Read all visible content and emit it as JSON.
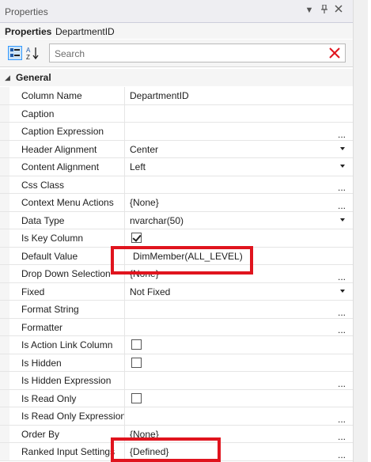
{
  "panel": {
    "title": "Properties",
    "header_label": "Properties",
    "object_name": "DepartmentID",
    "dropdown_icon": "chevron-down-icon",
    "pin_icon": "pin-icon",
    "close_icon": "close-icon"
  },
  "toolbar": {
    "categorized_icon": "categorized-icon",
    "alphabetical_icon": "sort-az-icon",
    "search_placeholder": "Search",
    "search_value": "",
    "clear_icon": "clear-search-icon"
  },
  "category": {
    "name": "General",
    "expanded_glyph": "◢"
  },
  "ellipsis": "...",
  "properties": [
    {
      "name": "Column Name",
      "value": "DepartmentID"
    },
    {
      "name": "Caption",
      "value": ""
    },
    {
      "name": "Caption Expression",
      "value": ""
    },
    {
      "name": "Header Alignment",
      "value": "Center"
    },
    {
      "name": "Content Alignment",
      "value": "Left"
    },
    {
      "name": "Css Class",
      "value": ""
    },
    {
      "name": "Context Menu Actions",
      "value": "{None}"
    },
    {
      "name": "Data Type",
      "value": "nvarchar(50)"
    },
    {
      "name": "Is Key Column",
      "value": "",
      "checked": true
    },
    {
      "name": "Default Value",
      "value": "DimMember(ALL_LEVEL)"
    },
    {
      "name": "Drop Down Selection",
      "value": "{None}"
    },
    {
      "name": "Fixed",
      "value": "Not Fixed"
    },
    {
      "name": "Format String",
      "value": ""
    },
    {
      "name": "Formatter",
      "value": ""
    },
    {
      "name": "Is Action Link Column",
      "value": "",
      "checked": false
    },
    {
      "name": "Is Hidden",
      "value": "",
      "checked": false
    },
    {
      "name": "Is Hidden Expression",
      "value": ""
    },
    {
      "name": "Is Read Only",
      "value": "",
      "checked": false
    },
    {
      "name": "Is Read Only Expression",
      "value": ""
    },
    {
      "name": "Order By",
      "value": "{None}"
    },
    {
      "name": "Ranked Input Settings",
      "value": "{Defined}"
    }
  ],
  "colors": {
    "highlight": "#e0141e",
    "selection_blue": "#3399ff"
  }
}
